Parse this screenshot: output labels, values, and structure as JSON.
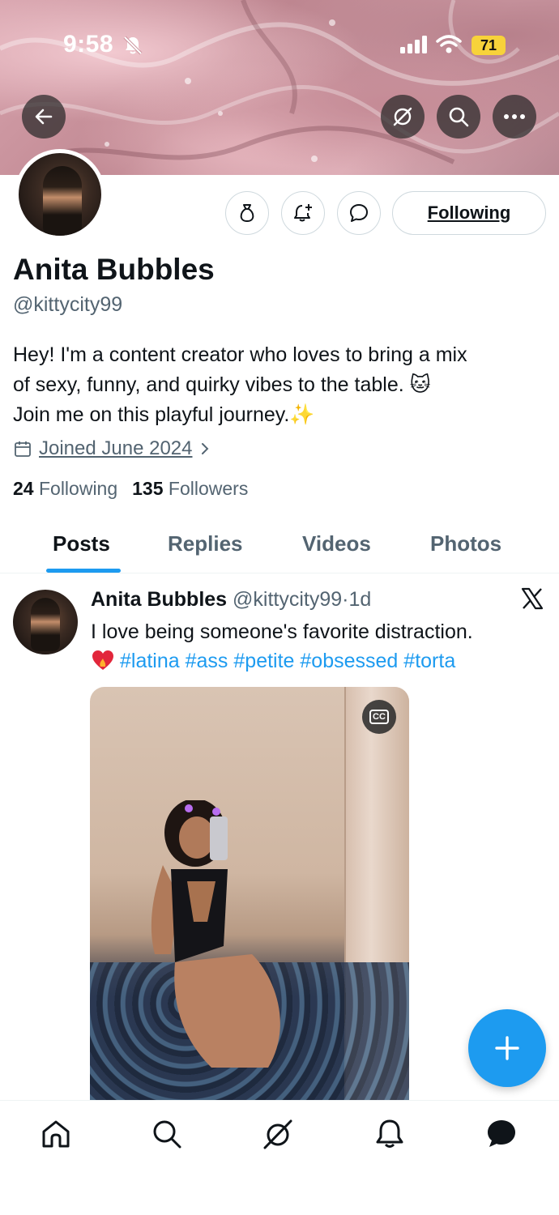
{
  "status_bar": {
    "time": "9:58",
    "battery": "71"
  },
  "header_actions": {
    "back_icon": "arrow-left-icon",
    "grok_icon": "grok-icon",
    "search_icon": "search-icon",
    "more_icon": "more-icon"
  },
  "profile": {
    "name": "Anita Bubbles",
    "handle": "@kittycity99",
    "bio_line1": "Hey! I'm a content creator who loves to bring a mix",
    "bio_line2": "of sexy, funny, and quirky vibes to the table. 🐱",
    "bio_line3": "Join me on this playful journey.✨",
    "joined": "Joined June 2024",
    "following_count": "24",
    "following_label": "Following",
    "followers_count": "135",
    "followers_label": "Followers",
    "follow_button_label": "Following"
  },
  "tabs": [
    {
      "label": "Posts",
      "active": true
    },
    {
      "label": "Replies",
      "active": false
    },
    {
      "label": "Videos",
      "active": false
    },
    {
      "label": "Photos",
      "active": false
    }
  ],
  "post": {
    "author_name": "Anita Bubbles",
    "author_handle": "@kittycity99",
    "separator": "·",
    "time": "1d",
    "text": "I love being someone's favorite distraction.",
    "hashtags": [
      "#latina",
      "#ass",
      "#petite",
      "#obsessed",
      "#torta"
    ],
    "cc_label": "CC"
  },
  "bottom_nav": [
    "home-icon",
    "search-icon",
    "grok-icon",
    "notifications-icon",
    "messages-icon"
  ],
  "colors": {
    "accent": "#1d9bf0",
    "text_primary": "#0f1419",
    "text_secondary": "#536471"
  }
}
